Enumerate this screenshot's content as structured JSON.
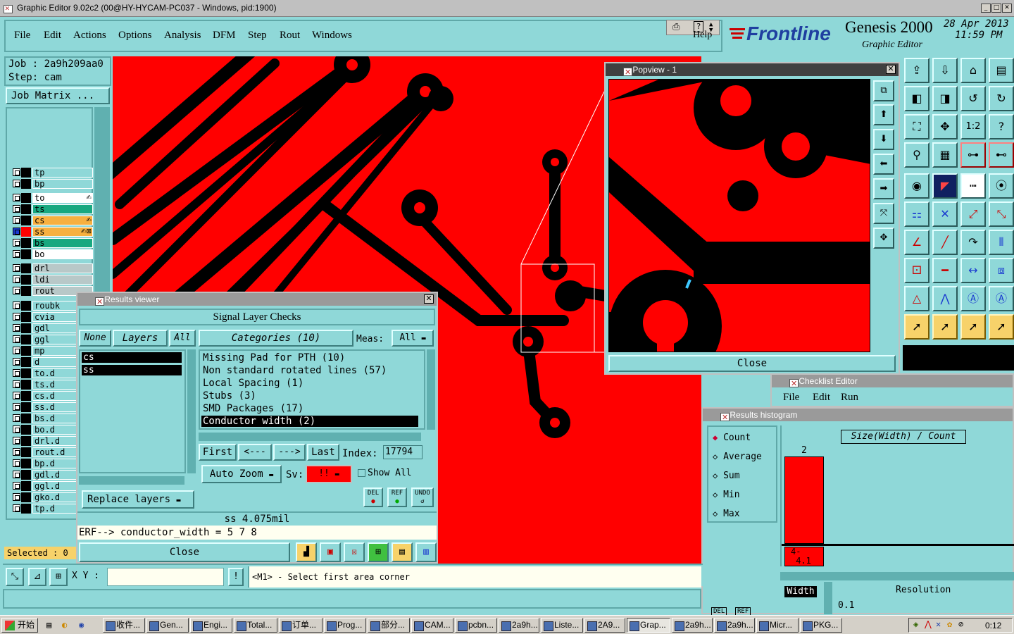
{
  "window": {
    "title": "Graphic Editor 9.02c2 (00@HY-HYCAM-PC037 - Windows, pid:1900)",
    "minimize": "_",
    "maximize": "□",
    "close": "✕"
  },
  "menu": {
    "items": [
      "File",
      "Edit",
      "Actions",
      "Options",
      "Analysis",
      "DFM",
      "Step",
      "Rout",
      "Windows"
    ],
    "help": "Help"
  },
  "brand": {
    "logo": "Frontline",
    "product": "Genesis 2000",
    "subtitle": "Graphic Editor",
    "date": "28 Apr 2013",
    "time": "11:59 PM"
  },
  "job": {
    "job": "Job : 2a9h209aa0",
    "step": "Step: cam",
    "matrix_button": "Job Matrix ..."
  },
  "layers": [
    {
      "name": "tp",
      "color": "#8fd8d8",
      "swatch": "#000000"
    },
    {
      "name": "bp",
      "color": "#8fd8d8",
      "swatch": "#000000"
    },
    {
      "name": "to",
      "color": "#ffffff",
      "swatch": "#000000",
      "mark": "✍"
    },
    {
      "name": "ts",
      "color": "#18a880",
      "swatch": "#000000"
    },
    {
      "name": "cs",
      "color": "#f7b040",
      "swatch": "#000000",
      "mark": "✍"
    },
    {
      "name": "ss",
      "color": "#f7b040",
      "swatch": "#ff0000",
      "mark": "✍⊠",
      "selected": true
    },
    {
      "name": "bs",
      "color": "#18a880",
      "swatch": "#000000"
    },
    {
      "name": "bo",
      "color": "#ffffff",
      "swatch": "#000000"
    },
    {
      "name": "drl",
      "color": "#b8c8c8",
      "swatch": "#000000"
    },
    {
      "name": "ldi",
      "color": "#b8c8c8",
      "swatch": "#000000"
    },
    {
      "name": "rout",
      "color": "#b8c8c8",
      "swatch": "#000000"
    },
    {
      "name": "roubk",
      "color": "#8fd8d8",
      "swatch": "#000000"
    },
    {
      "name": "cvia",
      "color": "#8fd8d8",
      "swatch": "#000000"
    },
    {
      "name": "gdl",
      "color": "#8fd8d8",
      "swatch": "#000000",
      "mark": "✍"
    },
    {
      "name": "ggl",
      "color": "#8fd8d8",
      "swatch": "#000000"
    },
    {
      "name": "mp",
      "color": "#8fd8d8",
      "swatch": "#000000"
    },
    {
      "name": "d",
      "color": "#8fd8d8",
      "swatch": "#000000"
    },
    {
      "name": "to.d",
      "color": "#8fd8d8",
      "swatch": "#000000"
    },
    {
      "name": "ts.d",
      "color": "#8fd8d8",
      "swatch": "#000000"
    },
    {
      "name": "cs.d",
      "color": "#8fd8d8",
      "swatch": "#000000"
    },
    {
      "name": "ss.d",
      "color": "#8fd8d8",
      "swatch": "#000000"
    },
    {
      "name": "bs.d",
      "color": "#8fd8d8",
      "swatch": "#000000"
    },
    {
      "name": "bo.d",
      "color": "#8fd8d8",
      "swatch": "#000000"
    },
    {
      "name": "drl.d",
      "color": "#8fd8d8",
      "swatch": "#000000"
    },
    {
      "name": "rout.d",
      "color": "#8fd8d8",
      "swatch": "#000000"
    },
    {
      "name": "bp.d",
      "color": "#8fd8d8",
      "swatch": "#000000"
    },
    {
      "name": "gdl.d",
      "color": "#8fd8d8",
      "swatch": "#000000"
    },
    {
      "name": "ggl.d",
      "color": "#8fd8d8",
      "swatch": "#000000"
    },
    {
      "name": "gko.d",
      "color": "#8fd8d8",
      "swatch": "#000000"
    },
    {
      "name": "tp.d",
      "color": "#8fd8d8",
      "swatch": "#000000"
    }
  ],
  "selected": "Selected : 0",
  "popview": {
    "title": "Popview - 1",
    "close": "Close"
  },
  "results": {
    "title": "Results viewer",
    "header": "Signal Layer Checks",
    "none": "None",
    "layers": "Layers",
    "all": "All",
    "layer_list": [
      "cs",
      "ss"
    ],
    "categories": "Categories (10)",
    "meas_label": "Meas:",
    "meas_value": "All",
    "items": [
      "Missing Pad for PTH (10)",
      "Non standard rotated lines (57)",
      "Local Spacing (1)",
      "Stubs (3)",
      "SMD Packages (17)",
      "Conductor width (2)"
    ],
    "first": "First",
    "prev": "<---",
    "next": "--->",
    "last": "Last",
    "index_label": "Index:",
    "index_value": "17794",
    "auto_zoom": "Auto Zoom",
    "sv_label": "Sv:",
    "sv_value": "!!",
    "show_all": "Show All",
    "replace_layers": "Replace layers",
    "del": "DEL",
    "ref": "REF",
    "undo": "UNDO",
    "measure": "ss 4.075mil",
    "erf": "ERF--> conductor_width = 5 7 8",
    "close": "Close"
  },
  "checklist": {
    "title": "Checklist Editor",
    "menu": [
      "File",
      "Edit",
      "Run"
    ]
  },
  "histogram": {
    "title": "Results histogram",
    "modes": [
      "Count",
      "Average",
      "Sum",
      "Min",
      "Max"
    ],
    "chart_title": "Size(Width) / Count",
    "bar_count": "2",
    "bin_label": "4-",
    "bin_label2": "4.1",
    "width_label": "Width",
    "resolution_label": "Resolution",
    "resolution_value": "0.1",
    "del": "DEL",
    "ref": "REF"
  },
  "status": {
    "xy_label": "X Y :",
    "prompt": "<M1> - Select first area corner",
    "excl": "!"
  },
  "taskbar": {
    "start": "开始",
    "tasks": [
      "收件...",
      "Gen...",
      "Engi...",
      "Total...",
      "订单...",
      "Prog...",
      "部分...",
      "CAM...",
      "pcbn...",
      "2a9h...",
      "Liste...",
      "2A9...",
      "Grap...",
      "2a9h...",
      "2a9h...",
      "Micr...",
      "PKG..."
    ],
    "active_index": 12,
    "clock": "0:12"
  },
  "colors": {
    "bg": "#8fd8d8",
    "board": "#ff0000",
    "trace": "#000000",
    "accent": "#f7d26a"
  }
}
